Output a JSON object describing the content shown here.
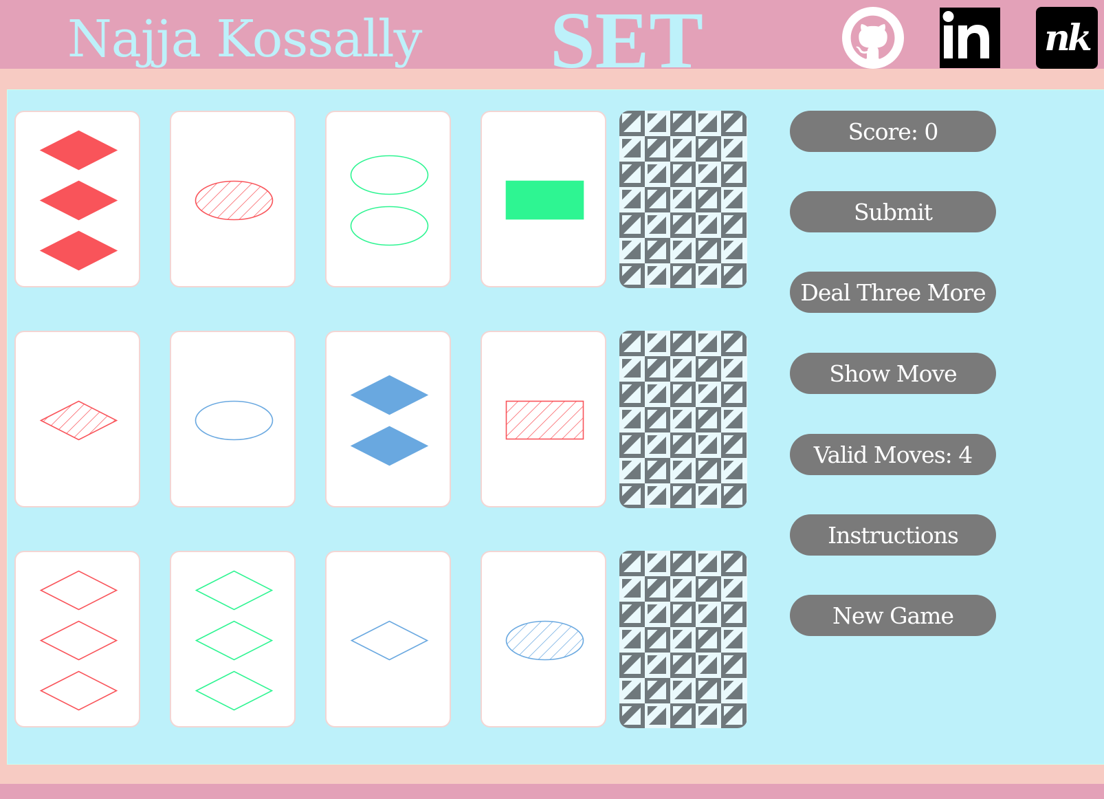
{
  "header": {
    "author": "Najja Kossally",
    "title": "SET",
    "links": [
      {
        "name": "github",
        "icon": "github-icon"
      },
      {
        "name": "linkedin",
        "icon": "linkedin-icon",
        "label": "in"
      },
      {
        "name": "portfolio",
        "icon": "nk-logo-icon",
        "label": "nk"
      }
    ]
  },
  "colors": {
    "header_bg": "#e3a1b8",
    "frame_bg": "#f7cbc3",
    "board_bg": "#bdf1fa",
    "button_bg": "#7a7a7a",
    "red": "#f9545a",
    "green": "#2ef592",
    "blue": "#69a8e0",
    "deck_dark": "#6f787c",
    "deck_light": "#eaf9fc"
  },
  "controls": {
    "score": "Score: 0",
    "submit": "Submit",
    "deal_three_more": "Deal Three More",
    "show_move": "Show Move",
    "valid_moves": "Valid Moves: 4",
    "instructions": "Instructions",
    "new_game": "New Game"
  },
  "cards": [
    {
      "count": 3,
      "shape": "diamond",
      "color": "red",
      "fill": "solid"
    },
    {
      "count": 1,
      "shape": "oval",
      "color": "red",
      "fill": "striped"
    },
    {
      "count": 2,
      "shape": "oval",
      "color": "green",
      "fill": "empty"
    },
    {
      "count": 1,
      "shape": "rectangle",
      "color": "green",
      "fill": "solid"
    },
    {
      "count": 1,
      "shape": "diamond",
      "color": "red",
      "fill": "striped"
    },
    {
      "count": 1,
      "shape": "oval",
      "color": "blue",
      "fill": "empty"
    },
    {
      "count": 2,
      "shape": "diamond",
      "color": "blue",
      "fill": "solid"
    },
    {
      "count": 1,
      "shape": "rectangle",
      "color": "red",
      "fill": "striped"
    },
    {
      "count": 3,
      "shape": "diamond",
      "color": "red",
      "fill": "empty"
    },
    {
      "count": 3,
      "shape": "diamond",
      "color": "green",
      "fill": "empty"
    },
    {
      "count": 1,
      "shape": "diamond",
      "color": "blue",
      "fill": "empty"
    },
    {
      "count": 1,
      "shape": "oval",
      "color": "blue",
      "fill": "striped"
    }
  ],
  "decks": [
    {
      "name": "deck-pile-1",
      "state": "face-down"
    },
    {
      "name": "deck-pile-2",
      "state": "face-down"
    },
    {
      "name": "deck-pile-3",
      "state": "face-down"
    }
  ]
}
